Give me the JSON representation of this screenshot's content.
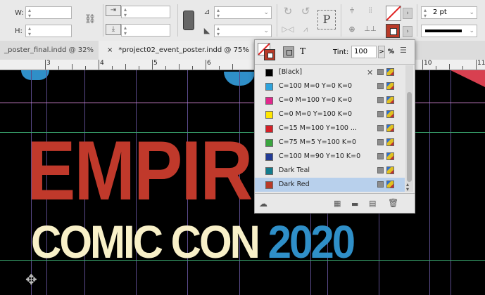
{
  "control_bar": {
    "w_label": "W:",
    "h_label": "H:",
    "stroke_weight": "2 pt",
    "text_frame_glyph": "P"
  },
  "tabs": [
    {
      "label": "_poster_final.indd @ 32%"
    },
    {
      "label": "*project02_event_poster.indd @ 75%",
      "close": "×"
    }
  ],
  "ruler": {
    "numbers": [
      "3",
      "4",
      "5",
      "6",
      "10",
      "11"
    ]
  },
  "canvas": {
    "headline": "EMPIR",
    "subline_a": "COMIC CON ",
    "subline_b": "2020",
    "colors": {
      "red": "#c0392b",
      "cream": "#f8f0c8",
      "blue": "#2f8fc8"
    }
  },
  "swatches_panel": {
    "text_icon": "T",
    "tint_label": "Tint:",
    "tint_value": "100",
    "tint_arrow": ">",
    "tint_unit": "%",
    "swatches": [
      {
        "name": "[Black]",
        "color": "#000000",
        "locked": true
      },
      {
        "name": "C=100 M=0 Y=0 K=0",
        "color": "#2ea3dc"
      },
      {
        "name": "C=0 M=100 Y=0 K=0",
        "color": "#e0288c"
      },
      {
        "name": "C=0 M=0 Y=100 K=0",
        "color": "#ffe600"
      },
      {
        "name": "C=15 M=100 Y=100 ...",
        "color": "#d42027"
      },
      {
        "name": "C=75 M=5 Y=100 K=0",
        "color": "#3aa53f"
      },
      {
        "name": "C=100 M=90 Y=10 K=0",
        "color": "#233c96"
      },
      {
        "name": "Dark Teal",
        "color": "#137c8c"
      },
      {
        "name": "Dark Red",
        "color": "#b83a28",
        "selected": true
      }
    ]
  }
}
